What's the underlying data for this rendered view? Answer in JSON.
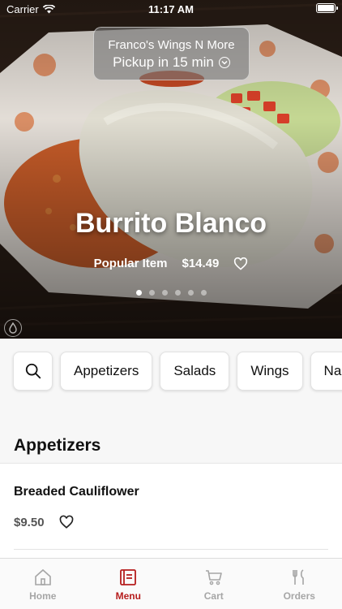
{
  "status_bar": {
    "carrier": "Carrier",
    "time": "11:17 AM"
  },
  "pickup": {
    "store": "Franco's Wings N More",
    "time": "Pickup in 15 min"
  },
  "hero": {
    "title": "Burrito Blanco",
    "tag": "Popular Item",
    "price": "$14.49",
    "slides": 6,
    "active_slide": 1
  },
  "categories": [
    "Appetizers",
    "Salads",
    "Wings",
    "Na"
  ],
  "section": {
    "title": "Appetizers"
  },
  "items": [
    {
      "name": "Breaded Cauliflower",
      "price": "$9.50"
    }
  ],
  "tabs": [
    {
      "label": "Home",
      "icon": "home-icon"
    },
    {
      "label": "Menu",
      "icon": "menu-icon"
    },
    {
      "label": "Cart",
      "icon": "cart-icon"
    },
    {
      "label": "Orders",
      "icon": "orders-icon"
    }
  ],
  "colors": {
    "accent": "#b61d1d",
    "tab_inactive": "#a6a6a6",
    "background": "#f7f7f7"
  }
}
